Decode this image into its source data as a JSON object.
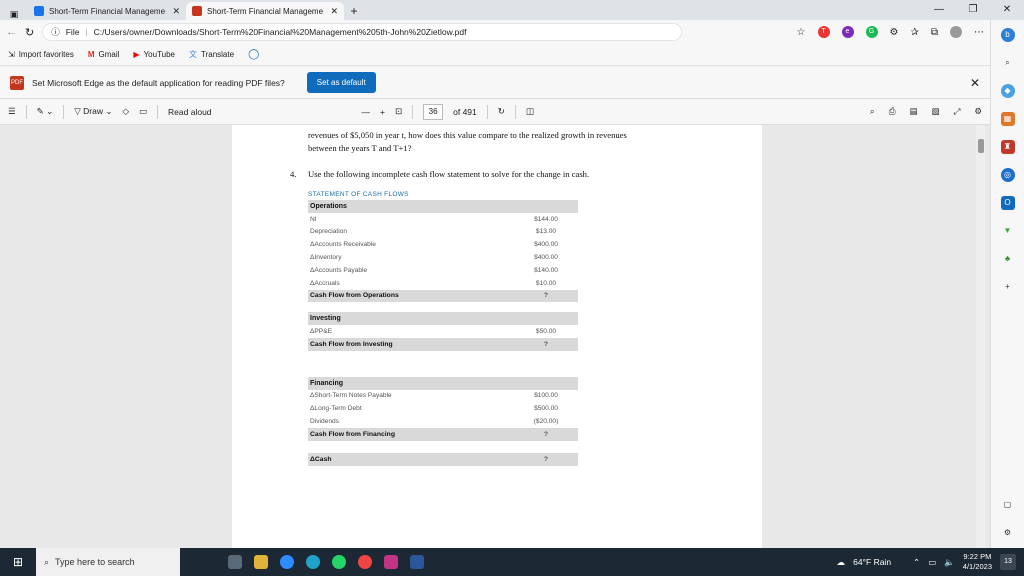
{
  "tabs": [
    {
      "title": "Short-Term Financial Manageme",
      "fav_color": "#1a73e8"
    },
    {
      "title": "Short-Term Financial Manageme",
      "fav_color": "#c5361f"
    }
  ],
  "address": {
    "prefix": "File",
    "url": "C:/Users/owner/Downloads/Short-Term%20Financial%20Management%205th-John%20Zietlow.pdf"
  },
  "favorites": [
    "Import favorites",
    "Gmail",
    "YouTube",
    "Translate"
  ],
  "infobar": {
    "message": "Set Microsoft Edge as the default application for reading PDF files?",
    "button": "Set as default"
  },
  "pdf_toolbar": {
    "draw": "Draw",
    "read_aloud": "Read aloud",
    "page": "36",
    "of_pages": "of 491"
  },
  "document": {
    "line1": "revenues of $5,050 in year t, how does this value compare to the realized growth in revenues",
    "line2": "between the years T and T+1?",
    "q_num": "4.",
    "q_text": "Use the following incomplete cash flow statement to solve for the change in cash.",
    "cf_title": "STATEMENT OF CASH FLOWS",
    "operations": {
      "header": "Operations",
      "rows": [
        [
          "NI",
          "$144.00"
        ],
        [
          "Depreciation",
          "$13.00"
        ],
        [
          "ΔAccounts Receivable",
          "$400.00"
        ],
        [
          "ΔInventory",
          "$400.00"
        ],
        [
          "ΔAccounts Payable",
          "$140.00"
        ],
        [
          "ΔAccruals",
          "$10.00"
        ]
      ],
      "total": [
        "Cash Flow from Operations",
        "?"
      ]
    },
    "investing": {
      "header": "Investing",
      "rows": [
        [
          "ΔPP&E",
          "$50.00"
        ]
      ],
      "total": [
        "Cash Flow from Investing",
        "?"
      ]
    },
    "financing": {
      "header": "Financing",
      "rows": [
        [
          "ΔShort-Term Notes Payable",
          "$100.00"
        ],
        [
          "ΔLong-Term Debt",
          "$500.00"
        ],
        [
          "Dividends",
          "($20.00)"
        ]
      ],
      "total": [
        "Cash Flow from Financing",
        "?"
      ]
    },
    "cash": [
      "ΔCash",
      "?"
    ]
  },
  "taskbar": {
    "search": "Type here to search",
    "weather": "64°F Rain",
    "time": "9:22 PM",
    "date": "4/1/2023",
    "notif": "13"
  }
}
